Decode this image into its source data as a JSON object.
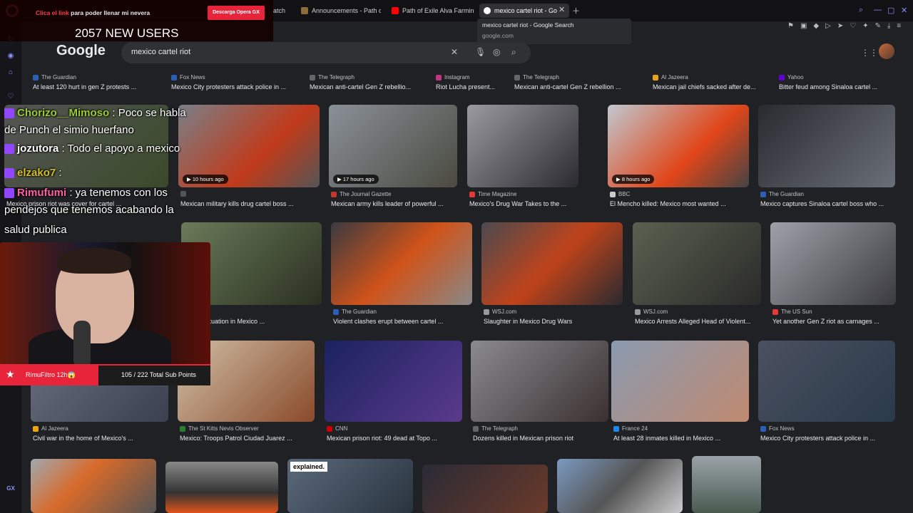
{
  "browser": {
    "tabs": [
      {
        "label": "atch"
      },
      {
        "label": "Announcements - Path of"
      },
      {
        "label": "Path of Exile Alva Farming"
      },
      {
        "label": "mexico cartel riot - Go"
      }
    ],
    "tooltip_title": "mexico cartel riot - Google Search",
    "tooltip_url": "google.com",
    "sidebar_gx": "GX"
  },
  "search": {
    "logo": "Google",
    "query": "mexico cartel riot"
  },
  "overlay": {
    "ad_link": "Clica el link",
    "ad_rest": " para poder llenar mi nevera",
    "ad_button": "Descarga Opera GX",
    "new_users": "2057 NEW USERS",
    "chat": [
      {
        "user": "Chorizo__Mimoso",
        "color": "#9acd32",
        "msg": " : Poco se habla"
      },
      {
        "user": "",
        "color": "#ffffff",
        "msg": "de Punch el simio huerfano"
      },
      {
        "user": "jozutora",
        "color": "#ffffff",
        "msg": " : Todo el apoyo a mexico"
      },
      {
        "user": "elzako7",
        "color": "#d4c020",
        "msg": " :"
      },
      {
        "user": "Rimufumi",
        "color": "#ff5fa0",
        "msg": " : ya tenemos con los"
      },
      {
        "user": "",
        "color": "#ffffff",
        "msg": "pendejos que tenemos acabando la"
      },
      {
        "user": "",
        "color": "#ffffff",
        "msg": "salud publica"
      }
    ],
    "sub_name": "RimuFiltro 12h😱",
    "sub_points": "105 / 222 Total Sub Points"
  },
  "results_row0": [
    {
      "source": "The Guardian",
      "title": "At least 120 hurt in gen Z protests ...",
      "fav": "#2b5fb3"
    },
    {
      "source": "Fox News",
      "title": "Mexico City protesters attack police in ...",
      "fav": "#2b5fb3"
    },
    {
      "source": "The Telegraph",
      "title": "Mexican anti-cartel Gen Z rebellio...",
      "fav": "#666"
    },
    {
      "source": "Instagram",
      "title": "Riot Lucha present...",
      "fav": "#c13584"
    },
    {
      "source": "The Telegraph",
      "title": "Mexican anti-cartel Gen Z rebellion ...",
      "fav": "#666"
    },
    {
      "source": "Al Jazeera",
      "title": "Mexican jail chiefs sacked after de...",
      "fav": "#e8a317"
    },
    {
      "source": "Yahoo",
      "title": "Bitter feud among Sinaloa cartel ...",
      "fav": "#6001d2"
    }
  ],
  "results_row1": [
    {
      "source": "",
      "title": "Mexico prison riot was cover for cartel ...",
      "badge": "",
      "fav": "#555"
    },
    {
      "source": "",
      "title": "Mexican military kills drug cartel boss ...",
      "badge": "10 hours ago",
      "fav": "#555"
    },
    {
      "source": "The Journal Gazette",
      "title": "Mexican army kills leader of powerful ...",
      "badge": "17 hours ago",
      "fav": "#c0392b"
    },
    {
      "source": "Time Magazine",
      "title": "Mexico's Drug War Takes to the ...",
      "badge": "",
      "fav": "#e53935"
    },
    {
      "source": "BBC",
      "title": "El Mencho killed: Mexico most wanted ...",
      "badge": "8 hours ago",
      "fav": "#ccc"
    },
    {
      "source": "The Guardian",
      "title": "Mexico captures Sinaloa cartel boss who ...",
      "badge": "",
      "fav": "#2b5fb3"
    }
  ],
  "results_row2": [
    {
      "source": "orld",
      "title": "arns of situation in Mexico ...",
      "fav": "#555"
    },
    {
      "source": "The Guardian",
      "title": "Violent clashes erupt between cartel ...",
      "fav": "#2b5fb3"
    },
    {
      "source": "WSJ.com",
      "title": "Slaughter in Mexico Drug Wars",
      "fav": "#999"
    },
    {
      "source": "WSJ.com",
      "title": "Mexico Arrests Alleged Head of Violent...",
      "fav": "#999"
    },
    {
      "source": "The US Sun",
      "title": "Yet another Gen Z riot as carnages ...",
      "fav": "#e53935"
    }
  ],
  "results_row3": [
    {
      "source": "Al Jazeera",
      "title": "Civil war in the home of Mexico's ...",
      "fav": "#e8a317"
    },
    {
      "source": "The St Kitts Nevis Observer",
      "title": "Mexico: Troops Patrol Ciudad Juarez ...",
      "fav": "#2e7d32"
    },
    {
      "source": "CNN",
      "title": "Mexican prison riot: 49 dead at Topo ...",
      "fav": "#cc0000"
    },
    {
      "source": "The Telegraph",
      "title": "Dozens killed in Mexican prison riot",
      "fav": "#666"
    },
    {
      "source": "France 24",
      "title": "At least 28 inmates killed in Mexico ...",
      "fav": "#1e88e5"
    },
    {
      "source": "Fox News",
      "title": "Mexico City protesters attack police in ...",
      "fav": "#2b5fb3"
    }
  ],
  "row4_label": "explained."
}
